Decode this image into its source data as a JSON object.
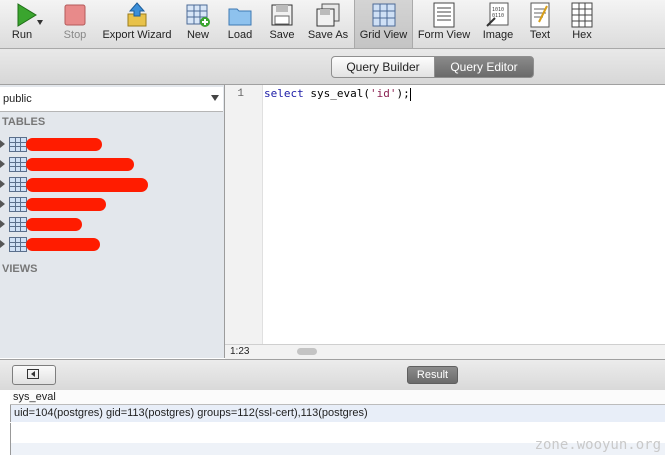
{
  "toolbar": {
    "buttons": [
      {
        "label": "Run",
        "icon": "play-icon"
      },
      {
        "label": "Stop",
        "icon": "stop-icon"
      },
      {
        "label": "Export Wizard",
        "icon": "export-icon"
      },
      {
        "label": "New",
        "icon": "new-table-icon"
      },
      {
        "label": "Load",
        "icon": "folder-icon"
      },
      {
        "label": "Save",
        "icon": "save-icon"
      },
      {
        "label": "Save As",
        "icon": "save-as-icon"
      },
      {
        "label": "Grid View",
        "icon": "grid-icon"
      },
      {
        "label": "Form View",
        "icon": "form-icon"
      },
      {
        "label": "Image",
        "icon": "image-icon"
      },
      {
        "label": "Text",
        "icon": "text-icon"
      },
      {
        "label": "Hex",
        "icon": "hex-icon"
      }
    ]
  },
  "modes": {
    "query_builder": "Query Builder",
    "query_editor": "Query Editor",
    "active": "Query Editor"
  },
  "sidebar": {
    "schema": "public",
    "tables_header": "TABLES",
    "views_header": "VIEWS",
    "tables_count": 6
  },
  "editor": {
    "line_number": "1",
    "code_keyword": "select",
    "code_func": " sys_eval(",
    "code_string": "'id'",
    "code_tail": ");",
    "cursor_position": "1:23"
  },
  "result": {
    "tab_label": "Result",
    "column": "sys_eval",
    "value": "uid=104(postgres) gid=113(postgres) groups=112(ssl-cert),113(postgres)"
  },
  "watermark": "zone.wooyun.org",
  "colors": {
    "redaction": "#ff1c00",
    "active_mode": "#6a6a6a"
  }
}
